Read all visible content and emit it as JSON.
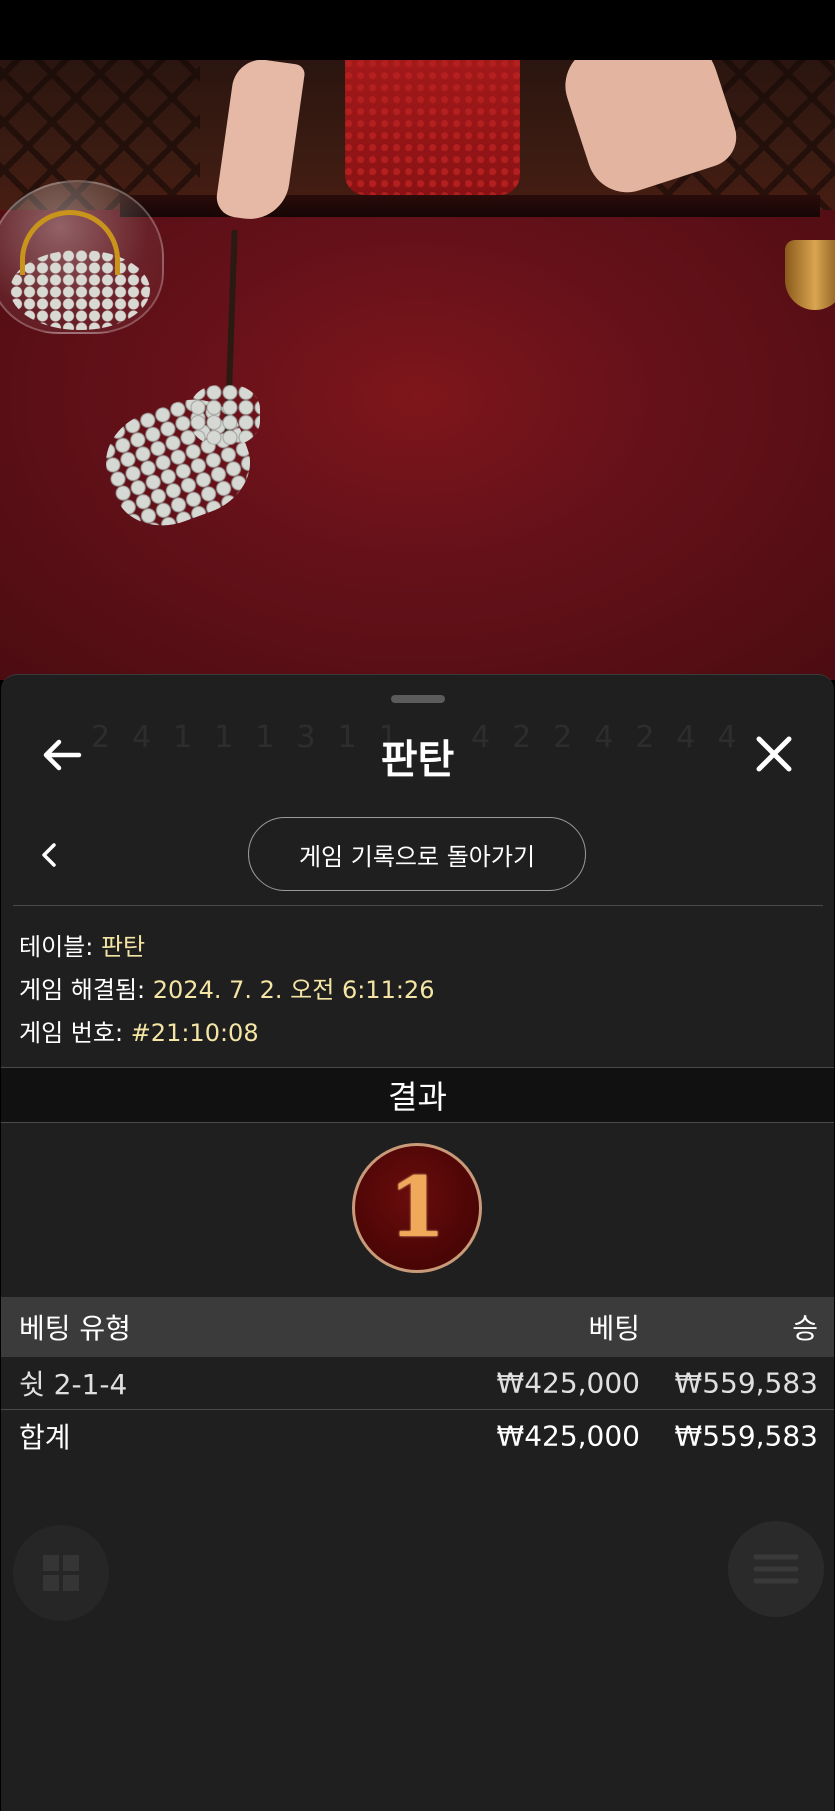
{
  "panel": {
    "title": "판탄",
    "return_button": "게임 기록으로 돌아가기"
  },
  "details": {
    "table_label": "테이블:",
    "table_value": "판탄",
    "resolved_label": "게임 해결됨:",
    "resolved_value": "2024. 7. 2. 오전 6:11:26",
    "game_number_label": "게임 번호:",
    "game_number_value": "#21:10:08"
  },
  "result": {
    "heading": "결과",
    "number": "1"
  },
  "bets_table": {
    "columns": [
      "베팅 유형",
      "베팅",
      "승"
    ],
    "rows": [
      {
        "type": "쉿 2-1-4",
        "bet": "₩425,000",
        "win": "₩559,583"
      }
    ],
    "total": {
      "type": "합계",
      "bet": "₩425,000",
      "win": "₩559,583"
    }
  },
  "colors": {
    "sheet_bg": "#1f1f1f",
    "value_text": "#f4e5a5",
    "table_header_bg": "#3b3b3b",
    "result_ball": "#4a0505"
  },
  "icons": [
    "back-arrow-icon",
    "close-icon",
    "chevron-left-icon"
  ]
}
